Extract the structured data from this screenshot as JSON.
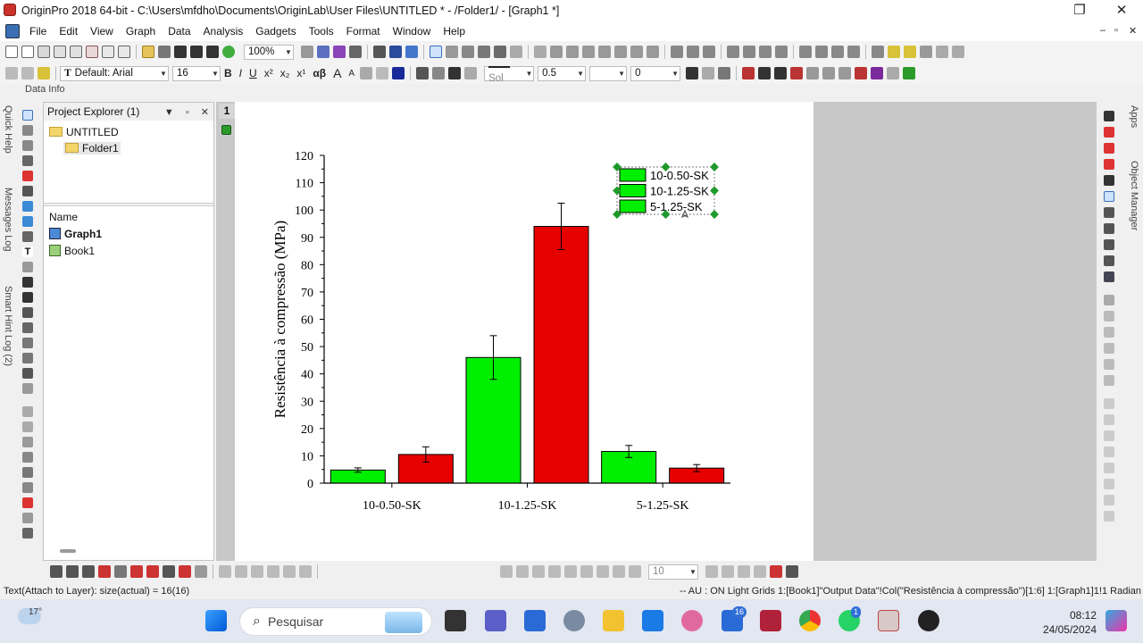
{
  "window": {
    "title": "OriginPro 2018 64-bit - C:\\Users\\mfdho\\Documents\\OriginLab\\User Files\\UNTITLED * - /Folder1/ - [Graph1 *]"
  },
  "menu": [
    "File",
    "Edit",
    "View",
    "Graph",
    "Data",
    "Analysis",
    "Gadgets",
    "Tools",
    "Format",
    "Window",
    "Help"
  ],
  "toolbar": {
    "zoom": "100%",
    "font_name": "Default: Arial",
    "font_size": "16",
    "line_style": "Sol",
    "line_width": "0.5",
    "angle": "0",
    "fmt_buttons": [
      "B",
      "I",
      "U",
      "x²",
      "x₂",
      "x¹",
      "αβ",
      "A",
      "A"
    ]
  },
  "data_info_label": "Data Info",
  "side_tabs": {
    "left": [
      "Quick Help",
      "Messages Log",
      "Smart Hint Log (2)"
    ],
    "right": [
      "Apps",
      "Object Manager"
    ]
  },
  "project_explorer": {
    "title": "Project Explorer (1)",
    "root": "UNTITLED",
    "folder": "Folder1",
    "list_header": "Name",
    "items": [
      {
        "name": "Graph1",
        "bold": true,
        "icon": "graph-icon"
      },
      {
        "name": "Book1",
        "bold": false,
        "icon": "workbook-icon"
      }
    ]
  },
  "layer_number": "1",
  "chart_data": {
    "type": "bar",
    "categories": [
      "10-0.50-SK",
      "10-1.25-SK",
      "5-1.25-SK"
    ],
    "series": [
      {
        "name": "10-0.50-SK",
        "color": "#00ee00",
        "values": [
          4.8,
          46,
          11.6
        ],
        "errors": [
          0.8,
          8,
          2.2
        ]
      },
      {
        "name": "",
        "color": "#e60000",
        "values": [
          10.5,
          94,
          5.5
        ],
        "errors": [
          2.8,
          8.5,
          1.3
        ]
      }
    ],
    "legend": [
      "10-0.50-SK",
      "10-1.25-SK",
      "5-1.25-SK"
    ],
    "legend_color": "#00ee00",
    "legend_placement": "top-right",
    "ylabel": "Resistência à compressão (MPa)",
    "xlabel": "",
    "ylim": [
      0,
      120
    ],
    "y_ticks": [
      0,
      10,
      20,
      30,
      40,
      50,
      60,
      70,
      80,
      90,
      100,
      110,
      120
    ],
    "grid": false
  },
  "bottom_zoom": "10",
  "status": {
    "left": "Text(Attach to Layer): size(actual) = 16(16)",
    "right": "--   AU : ON  Light Grids  1:[Book1]\"Output Data\"!Col(\"Resistência à compressão\")[1:6]  1:[Graph1]1!1  Radian"
  },
  "taskbar": {
    "weather": "17°",
    "search": "Pesquisar",
    "time": "08:12",
    "date": "24/05/2024",
    "badges": {
      "teams": "16",
      "whatsapp": "1"
    }
  }
}
